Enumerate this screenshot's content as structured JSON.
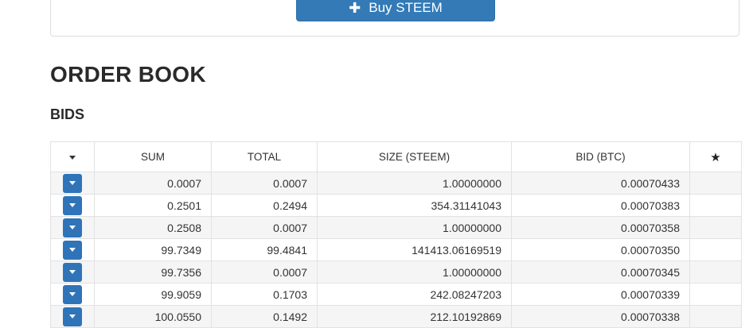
{
  "buy_button": {
    "label": "Buy STEEM",
    "icon": "plus-icon"
  },
  "headings": {
    "order_book": "ORDER BOOK",
    "bids": "BIDS"
  },
  "table": {
    "columns": [
      "SUM",
      "TOTAL",
      "SIZE (STEEM)",
      "BID (BTC)"
    ],
    "rows": [
      {
        "sum": "0.0007",
        "total": "0.0007",
        "size": "1.00000000",
        "bid": "0.00070433"
      },
      {
        "sum": "0.2501",
        "total": "0.2494",
        "size": "354.31141043",
        "bid": "0.00070383"
      },
      {
        "sum": "0.2508",
        "total": "0.0007",
        "size": "1.00000000",
        "bid": "0.00070358"
      },
      {
        "sum": "99.7349",
        "total": "99.4841",
        "size": "141413.06169519",
        "bid": "0.00070350"
      },
      {
        "sum": "99.7356",
        "total": "0.0007",
        "size": "1.00000000",
        "bid": "0.00070345"
      },
      {
        "sum": "99.9059",
        "total": "0.1703",
        "size": "242.08247203",
        "bid": "0.00070339"
      },
      {
        "sum": "100.0550",
        "total": "0.1492",
        "size": "212.10192869",
        "bid": "0.00070338"
      }
    ]
  }
}
